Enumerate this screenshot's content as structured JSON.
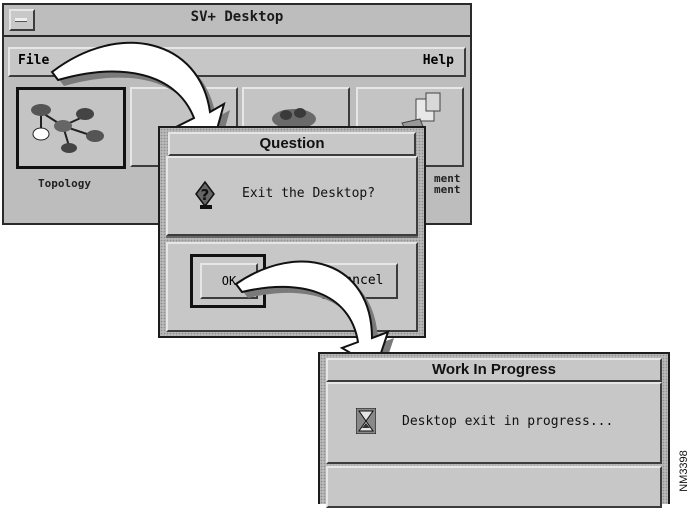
{
  "desktop": {
    "title": "SV+ Desktop",
    "menu": {
      "file": "File",
      "help": "Help"
    },
    "tiles": [
      {
        "label": "Topology",
        "icon": "network-topology-icon",
        "selected": true
      },
      {
        "label": "",
        "icon": "application-icon",
        "selected": false
      },
      {
        "label": "",
        "icon": "group-icon",
        "selected": false
      },
      {
        "label": "",
        "icon": "management-icon",
        "selected": false
      }
    ],
    "partial_labels": {
      "left": "t",
      "right_line1": "ment",
      "right_line2": "ment"
    }
  },
  "question": {
    "title": "Question",
    "message": "Exit the Desktop?",
    "icon": "question-icon",
    "ok_label": "OK",
    "cancel_label": "Cancel"
  },
  "progress": {
    "title": "Work In Progress",
    "message": "Desktop exit in progress...",
    "icon": "hourglass-icon"
  },
  "figure_code": "NM3398",
  "colors": {
    "window": "#c7c7c7",
    "frame": "#1c1c1c",
    "arrow_fill": "#ffffff",
    "arrow_shadow": "#7a7a7a"
  }
}
